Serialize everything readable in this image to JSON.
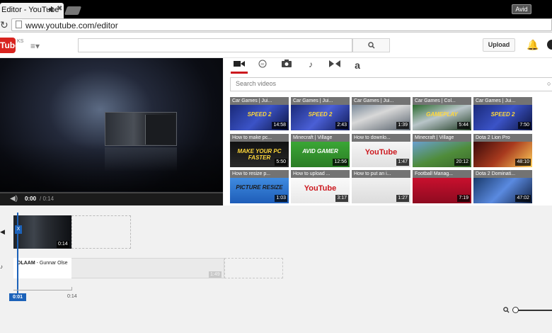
{
  "browser": {
    "tab_title": "Editor - YouTube",
    "tab_speaker_icon": "speaker-icon",
    "tab_close": "✖",
    "user_badge": "Avid",
    "url": "www.youtube.com/editor"
  },
  "header": {
    "logo_text": "Tube",
    "region": "KS",
    "upload_label": "Upload"
  },
  "player": {
    "time_current": "0:00",
    "time_total": "/ 0:14"
  },
  "media_tabs": [
    "video-camera",
    "cc",
    "photo",
    "music",
    "transitions",
    "text"
  ],
  "media_search_placeholder": "Search videos",
  "thumbnails": [
    {
      "title": "Car Games | Jui...",
      "duration": "14:58",
      "art": "SPEED 2"
    },
    {
      "title": "Car Games | Jui...",
      "duration": "2:43",
      "art": "SPEED 2"
    },
    {
      "title": "Car Games | Jui...",
      "duration": "1:39",
      "art": ""
    },
    {
      "title": "Car Games | Col...",
      "duration": "5:44",
      "art": "GAMEPLAY"
    },
    {
      "title": "Car Games | Jui...",
      "duration": "7:50",
      "art": "SPEED 2"
    },
    {
      "title": "How to make pc...",
      "duration": "5:50",
      "art": "MAKE YOUR PC FASTER"
    },
    {
      "title": "Minecraft | Village",
      "duration": "12:56",
      "art": "AVID GAMER"
    },
    {
      "title": "How to downlo...",
      "duration": "1:47",
      "art": "YouTube"
    },
    {
      "title": "Minecraft | Village",
      "duration": "20:12",
      "art": ""
    },
    {
      "title": "Dota 2 Lion Pro",
      "duration": "48:10",
      "art": ""
    },
    {
      "title": "How to resize p...",
      "duration": "1:03",
      "art": "PICTURE RESIZE"
    },
    {
      "title": "How to upload ...",
      "duration": "3:17",
      "art": "YouTube"
    },
    {
      "title": "How to put an i...",
      "duration": "1:27",
      "art": ""
    },
    {
      "title": "Football Manag...",
      "duration": "7:19",
      "art": ""
    },
    {
      "title": "Dota 2 Dominati...",
      "duration": "47:02",
      "art": ""
    }
  ],
  "timeline": {
    "clip_duration": "0:14",
    "audio_title": "OLAAM",
    "audio_artist": " - Gunnar Olse",
    "audio_end": "1:49",
    "playhead_label": "X",
    "time_start": "0:01",
    "time_end": "0:14"
  },
  "colors": {
    "brand_red": "#cc181e",
    "accent_blue": "#1c62b9"
  }
}
